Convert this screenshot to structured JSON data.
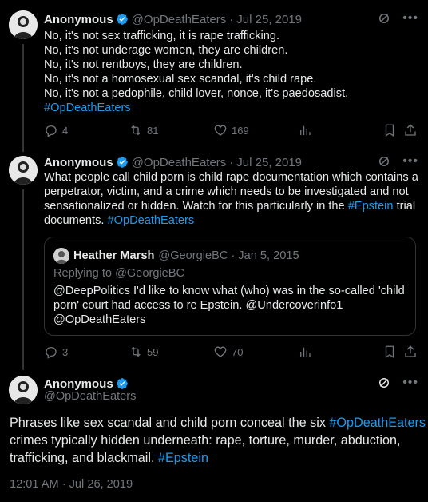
{
  "colors": {
    "background": "#000000",
    "text": "#e7e9ea",
    "muted": "#71767b",
    "link": "#1d9bf0",
    "verified": "#1d9bf0"
  },
  "tweets": [
    {
      "name": "Anonymous",
      "handle": "@OpDeathEaters",
      "separator": "·",
      "date": "Jul 25, 2019",
      "lines": [
        "No, it's not sex trafficking, it is rape trafficking.",
        "No, it's not underage women, they are children.",
        "No, it's not rentboys, they are children.",
        "No, it's not a homosexual sex scandal, it's child rape.",
        "No, it's not a pedophile, child lover, nonce, it's paedosadist."
      ],
      "hashtag": "#OpDeathEaters",
      "replies": "4",
      "retweets": "81",
      "likes": "169"
    },
    {
      "name": "Anonymous",
      "handle": "@OpDeathEaters",
      "separator": "·",
      "date": "Jul 25, 2019",
      "line1": "What people call child porn is child rape documentation which contains a",
      "line2": "perpetrator, victim, and a crime which needs to be investigated and not",
      "line3_pre": "sensationalized or hidden. Watch for this particularly in the ",
      "line3_tag": "#Epstein",
      "line3_post": " trial",
      "line4_pre": "documents. ",
      "line4_tag": "#OpDeathEaters",
      "quote": {
        "name": "Heather Marsh",
        "handle": "@GeorgieBC",
        "separator": "·",
        "date": "Jan 5, 2015",
        "reply": "Replying to @GeorgieBC",
        "line1": "@DeepPolitics I'd like to know what (who) was in the so-called 'child",
        "line2": "porn' court had access to re Epstein. @Undercoverinfo1",
        "line3": "@OpDeathEaters"
      },
      "replies": "3",
      "retweets": "59",
      "likes": "70"
    },
    {
      "name": "Anonymous",
      "handle": "@OpDeathEaters",
      "line1_pre": "Phrases like sex scandal and child porn conceal the six ",
      "line1_tag": "#OpDeathEaters",
      "line2": "crimes typically hidden underneath: rape, torture, murder, abduction,",
      "line3_pre": "trafficking, and blackmail. ",
      "line3_tag": "#Epstein",
      "timestamp": "12:01 AM · Jul 26, 2019"
    }
  ],
  "icons": [
    "verified-badge-icon",
    "grok-icon",
    "more-icon",
    "reply-icon",
    "retweet-icon",
    "like-icon",
    "views-icon",
    "bookmark-icon",
    "share-icon"
  ]
}
